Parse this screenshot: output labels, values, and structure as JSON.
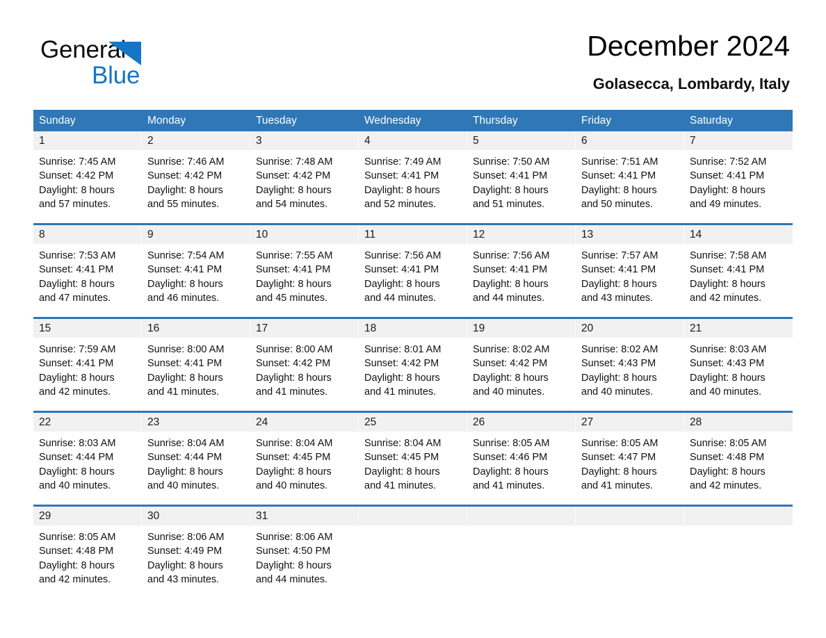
{
  "brand": {
    "name_part1": "General",
    "name_part2": "Blue",
    "triangle_icon": "blue-triangle-icon",
    "accent_color": "#1575c6"
  },
  "header": {
    "title": "December 2024",
    "subtitle": "Golasecca, Lombardy, Italy"
  },
  "colors": {
    "header_blue": "#2f77b6",
    "daynum_band": "#f1f1f1",
    "text": "#111111",
    "header_text": "#ffffff"
  },
  "weekdays": [
    "Sunday",
    "Monday",
    "Tuesday",
    "Wednesday",
    "Thursday",
    "Friday",
    "Saturday"
  ],
  "weeks": [
    [
      {
        "day": "1",
        "sunrise": "Sunrise: 7:45 AM",
        "sunset": "Sunset: 4:42 PM",
        "daylight_line1": "Daylight: 8 hours",
        "daylight_line2": "and 57 minutes."
      },
      {
        "day": "2",
        "sunrise": "Sunrise: 7:46 AM",
        "sunset": "Sunset: 4:42 PM",
        "daylight_line1": "Daylight: 8 hours",
        "daylight_line2": "and 55 minutes."
      },
      {
        "day": "3",
        "sunrise": "Sunrise: 7:48 AM",
        "sunset": "Sunset: 4:42 PM",
        "daylight_line1": "Daylight: 8 hours",
        "daylight_line2": "and 54 minutes."
      },
      {
        "day": "4",
        "sunrise": "Sunrise: 7:49 AM",
        "sunset": "Sunset: 4:41 PM",
        "daylight_line1": "Daylight: 8 hours",
        "daylight_line2": "and 52 minutes."
      },
      {
        "day": "5",
        "sunrise": "Sunrise: 7:50 AM",
        "sunset": "Sunset: 4:41 PM",
        "daylight_line1": "Daylight: 8 hours",
        "daylight_line2": "and 51 minutes."
      },
      {
        "day": "6",
        "sunrise": "Sunrise: 7:51 AM",
        "sunset": "Sunset: 4:41 PM",
        "daylight_line1": "Daylight: 8 hours",
        "daylight_line2": "and 50 minutes."
      },
      {
        "day": "7",
        "sunrise": "Sunrise: 7:52 AM",
        "sunset": "Sunset: 4:41 PM",
        "daylight_line1": "Daylight: 8 hours",
        "daylight_line2": "and 49 minutes."
      }
    ],
    [
      {
        "day": "8",
        "sunrise": "Sunrise: 7:53 AM",
        "sunset": "Sunset: 4:41 PM",
        "daylight_line1": "Daylight: 8 hours",
        "daylight_line2": "and 47 minutes."
      },
      {
        "day": "9",
        "sunrise": "Sunrise: 7:54 AM",
        "sunset": "Sunset: 4:41 PM",
        "daylight_line1": "Daylight: 8 hours",
        "daylight_line2": "and 46 minutes."
      },
      {
        "day": "10",
        "sunrise": "Sunrise: 7:55 AM",
        "sunset": "Sunset: 4:41 PM",
        "daylight_line1": "Daylight: 8 hours",
        "daylight_line2": "and 45 minutes."
      },
      {
        "day": "11",
        "sunrise": "Sunrise: 7:56 AM",
        "sunset": "Sunset: 4:41 PM",
        "daylight_line1": "Daylight: 8 hours",
        "daylight_line2": "and 44 minutes."
      },
      {
        "day": "12",
        "sunrise": "Sunrise: 7:56 AM",
        "sunset": "Sunset: 4:41 PM",
        "daylight_line1": "Daylight: 8 hours",
        "daylight_line2": "and 44 minutes."
      },
      {
        "day": "13",
        "sunrise": "Sunrise: 7:57 AM",
        "sunset": "Sunset: 4:41 PM",
        "daylight_line1": "Daylight: 8 hours",
        "daylight_line2": "and 43 minutes."
      },
      {
        "day": "14",
        "sunrise": "Sunrise: 7:58 AM",
        "sunset": "Sunset: 4:41 PM",
        "daylight_line1": "Daylight: 8 hours",
        "daylight_line2": "and 42 minutes."
      }
    ],
    [
      {
        "day": "15",
        "sunrise": "Sunrise: 7:59 AM",
        "sunset": "Sunset: 4:41 PM",
        "daylight_line1": "Daylight: 8 hours",
        "daylight_line2": "and 42 minutes."
      },
      {
        "day": "16",
        "sunrise": "Sunrise: 8:00 AM",
        "sunset": "Sunset: 4:41 PM",
        "daylight_line1": "Daylight: 8 hours",
        "daylight_line2": "and 41 minutes."
      },
      {
        "day": "17",
        "sunrise": "Sunrise: 8:00 AM",
        "sunset": "Sunset: 4:42 PM",
        "daylight_line1": "Daylight: 8 hours",
        "daylight_line2": "and 41 minutes."
      },
      {
        "day": "18",
        "sunrise": "Sunrise: 8:01 AM",
        "sunset": "Sunset: 4:42 PM",
        "daylight_line1": "Daylight: 8 hours",
        "daylight_line2": "and 41 minutes."
      },
      {
        "day": "19",
        "sunrise": "Sunrise: 8:02 AM",
        "sunset": "Sunset: 4:42 PM",
        "daylight_line1": "Daylight: 8 hours",
        "daylight_line2": "and 40 minutes."
      },
      {
        "day": "20",
        "sunrise": "Sunrise: 8:02 AM",
        "sunset": "Sunset: 4:43 PM",
        "daylight_line1": "Daylight: 8 hours",
        "daylight_line2": "and 40 minutes."
      },
      {
        "day": "21",
        "sunrise": "Sunrise: 8:03 AM",
        "sunset": "Sunset: 4:43 PM",
        "daylight_line1": "Daylight: 8 hours",
        "daylight_line2": "and 40 minutes."
      }
    ],
    [
      {
        "day": "22",
        "sunrise": "Sunrise: 8:03 AM",
        "sunset": "Sunset: 4:44 PM",
        "daylight_line1": "Daylight: 8 hours",
        "daylight_line2": "and 40 minutes."
      },
      {
        "day": "23",
        "sunrise": "Sunrise: 8:04 AM",
        "sunset": "Sunset: 4:44 PM",
        "daylight_line1": "Daylight: 8 hours",
        "daylight_line2": "and 40 minutes."
      },
      {
        "day": "24",
        "sunrise": "Sunrise: 8:04 AM",
        "sunset": "Sunset: 4:45 PM",
        "daylight_line1": "Daylight: 8 hours",
        "daylight_line2": "and 40 minutes."
      },
      {
        "day": "25",
        "sunrise": "Sunrise: 8:04 AM",
        "sunset": "Sunset: 4:45 PM",
        "daylight_line1": "Daylight: 8 hours",
        "daylight_line2": "and 41 minutes."
      },
      {
        "day": "26",
        "sunrise": "Sunrise: 8:05 AM",
        "sunset": "Sunset: 4:46 PM",
        "daylight_line1": "Daylight: 8 hours",
        "daylight_line2": "and 41 minutes."
      },
      {
        "day": "27",
        "sunrise": "Sunrise: 8:05 AM",
        "sunset": "Sunset: 4:47 PM",
        "daylight_line1": "Daylight: 8 hours",
        "daylight_line2": "and 41 minutes."
      },
      {
        "day": "28",
        "sunrise": "Sunrise: 8:05 AM",
        "sunset": "Sunset: 4:48 PM",
        "daylight_line1": "Daylight: 8 hours",
        "daylight_line2": "and 42 minutes."
      }
    ],
    [
      {
        "day": "29",
        "sunrise": "Sunrise: 8:05 AM",
        "sunset": "Sunset: 4:48 PM",
        "daylight_line1": "Daylight: 8 hours",
        "daylight_line2": "and 42 minutes."
      },
      {
        "day": "30",
        "sunrise": "Sunrise: 8:06 AM",
        "sunset": "Sunset: 4:49 PM",
        "daylight_line1": "Daylight: 8 hours",
        "daylight_line2": "and 43 minutes."
      },
      {
        "day": "31",
        "sunrise": "Sunrise: 8:06 AM",
        "sunset": "Sunset: 4:50 PM",
        "daylight_line1": "Daylight: 8 hours",
        "daylight_line2": "and 44 minutes."
      },
      {
        "day": "",
        "sunrise": "",
        "sunset": "",
        "daylight_line1": "",
        "daylight_line2": ""
      },
      {
        "day": "",
        "sunrise": "",
        "sunset": "",
        "daylight_line1": "",
        "daylight_line2": ""
      },
      {
        "day": "",
        "sunrise": "",
        "sunset": "",
        "daylight_line1": "",
        "daylight_line2": ""
      },
      {
        "day": "",
        "sunrise": "",
        "sunset": "",
        "daylight_line1": "",
        "daylight_line2": ""
      }
    ]
  ]
}
